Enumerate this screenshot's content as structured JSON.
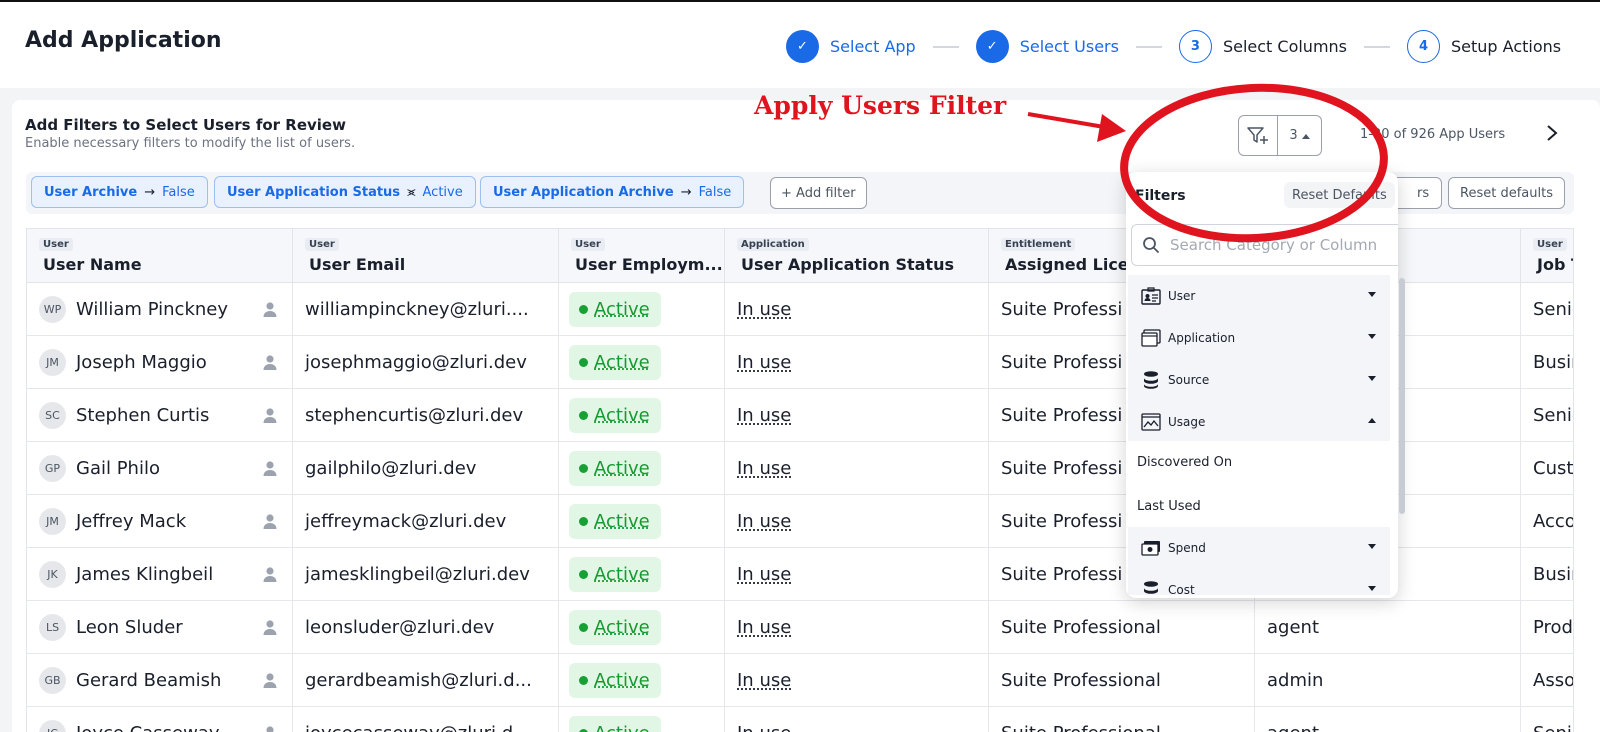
{
  "header": {
    "title": "Add Application",
    "steps": [
      {
        "num": "✓",
        "label": "Select App",
        "state": "done"
      },
      {
        "num": "✓",
        "label": "Select Users",
        "state": "done"
      },
      {
        "num": "3",
        "label": "Select Columns",
        "state": "todo"
      },
      {
        "num": "4",
        "label": "Setup Actions",
        "state": "todo"
      }
    ]
  },
  "card": {
    "title": "Add Filters to Select Users for Review",
    "subtitle": "Enable necessary filters to modify the list of users.",
    "filter_count": "3",
    "pagination": "1-20 of 926 App Users"
  },
  "chips": [
    {
      "key": "User Archive",
      "op": "→",
      "value": "False"
    },
    {
      "key": "User Application Status",
      "op": "⪤",
      "value": "Active"
    },
    {
      "key": "User Application Archive",
      "op": "→",
      "value": "False"
    }
  ],
  "chip_actions": {
    "add_filter": "+ Add filter",
    "partial": "rs",
    "reset": "Reset defaults"
  },
  "table": {
    "columns": [
      {
        "tag": "User",
        "label": "User Name"
      },
      {
        "tag": "User",
        "label": "User Email"
      },
      {
        "tag": "User",
        "label": "User Employm..."
      },
      {
        "tag": "Application",
        "label": "User Application Status"
      },
      {
        "tag": "Entitlement",
        "label": "Assigned Licen"
      },
      {
        "tag": "",
        "label": ""
      },
      {
        "tag": "User",
        "label": "Job T"
      }
    ],
    "rows": [
      {
        "initials": "WP",
        "name": "William Pinckney",
        "email": "williampinckney@zluri....",
        "status": "Active",
        "app_status": "In use",
        "license": "Suite Professi",
        "role": "",
        "job": "Senio"
      },
      {
        "initials": "JM",
        "name": "Joseph Maggio",
        "email": "josephmaggio@zluri.dev",
        "status": "Active",
        "app_status": "In use",
        "license": "Suite Professi",
        "role": "",
        "job": "Busin"
      },
      {
        "initials": "SC",
        "name": "Stephen Curtis",
        "email": "stephencurtis@zluri.dev",
        "status": "Active",
        "app_status": "In use",
        "license": "Suite Professi",
        "role": "",
        "job": "Senio"
      },
      {
        "initials": "GP",
        "name": "Gail Philo",
        "email": "gailphilo@zluri.dev",
        "status": "Active",
        "app_status": "In use",
        "license": "Suite Professi",
        "role": "",
        "job": "Custo"
      },
      {
        "initials": "JM",
        "name": "Jeffrey Mack",
        "email": "jeffreymack@zluri.dev",
        "status": "Active",
        "app_status": "In use",
        "license": "Suite Professi",
        "role": "",
        "job": "Acco"
      },
      {
        "initials": "JK",
        "name": "James Klingbeil",
        "email": "jamesklingbeil@zluri.dev",
        "status": "Active",
        "app_status": "In use",
        "license": "Suite Professi",
        "role": "",
        "job": "Busin"
      },
      {
        "initials": "LS",
        "name": "Leon Sluder",
        "email": "leonsluder@zluri.dev",
        "status": "Active",
        "app_status": "In use",
        "license": "Suite Professional",
        "role": "agent",
        "job": "Prod"
      },
      {
        "initials": "GB",
        "name": "Gerard Beamish",
        "email": "gerardbeamish@zluri.d...",
        "status": "Active",
        "app_status": "In use",
        "license": "Suite Professional",
        "role": "admin",
        "job": "Asso"
      },
      {
        "initials": "JC",
        "name": "Joyce Casseway",
        "email": "joycecasseway@zluri.d...",
        "status": "Active",
        "app_status": "In use",
        "license": "Suite Professional",
        "role": "agent",
        "job": "Senio"
      }
    ]
  },
  "dropdown": {
    "title": "Filters",
    "reset": "Reset Defaults",
    "search_placeholder": "Search Category or Column",
    "items": [
      {
        "label": "User",
        "kind": "cat",
        "caret": "down",
        "icon": "user-card-icon"
      },
      {
        "label": "Application",
        "kind": "cat",
        "caret": "down",
        "icon": "application-window-icon"
      },
      {
        "label": "Source",
        "kind": "cat",
        "caret": "down",
        "icon": "database-icon"
      },
      {
        "label": "Usage",
        "kind": "cat",
        "caret": "up",
        "icon": "usage-chart-icon"
      },
      {
        "label": "Discovered On",
        "kind": "sub"
      },
      {
        "label": "Last Used",
        "kind": "sub"
      },
      {
        "label": "Spend",
        "kind": "cat",
        "caret": "down",
        "icon": "money-icon"
      },
      {
        "label": "Cost",
        "kind": "cat",
        "caret": "down",
        "icon": "database-icon"
      }
    ]
  },
  "annotation": {
    "text": "Apply Users Filter",
    "color": "#e0141e"
  },
  "colors": {
    "accent": "#1a6ae8",
    "active_green": "#17a034",
    "active_bg": "#e2f6e6"
  }
}
